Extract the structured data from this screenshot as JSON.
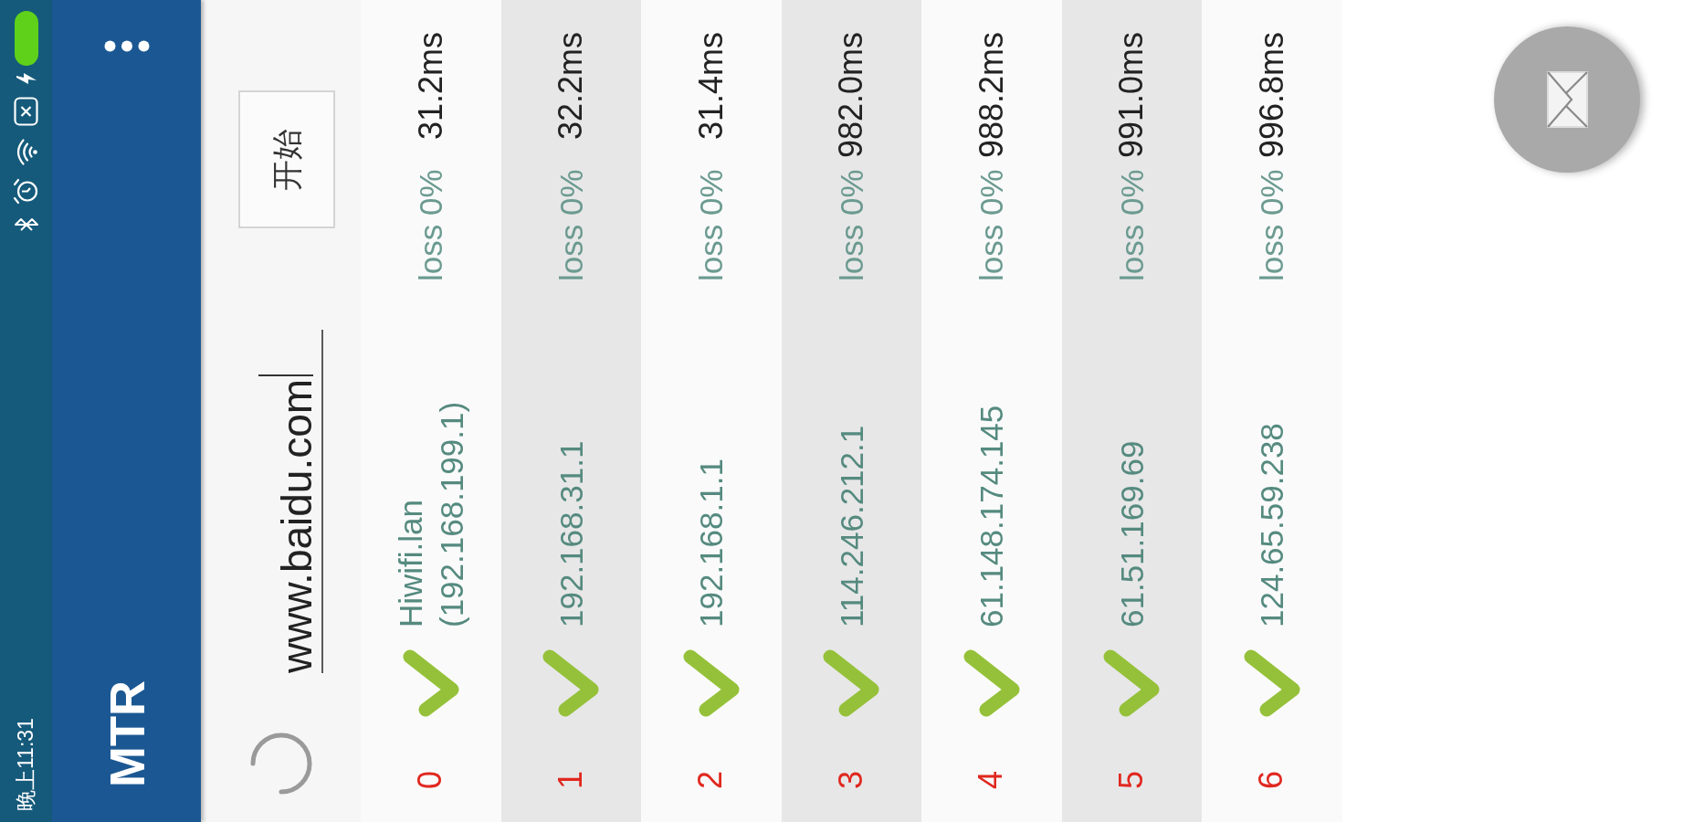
{
  "status_bar": {
    "time": "晚上11:31"
  },
  "app_bar": {
    "title": "MTR"
  },
  "toolbar": {
    "loading": true,
    "host_field": {
      "value": "www.baidu.com"
    },
    "start_button": {
      "label": "开始"
    }
  },
  "hops": [
    {
      "index": "0",
      "reachable": true,
      "host": "Hiwifi.lan (192.168.199.1)",
      "loss": "loss 0%",
      "latency": "31.2ms"
    },
    {
      "index": "1",
      "reachable": true,
      "host": "192.168.31.1",
      "loss": "loss 0%",
      "latency": "32.2ms"
    },
    {
      "index": "2",
      "reachable": true,
      "host": "192.168.1.1",
      "loss": "loss 0%",
      "latency": "31.4ms"
    },
    {
      "index": "3",
      "reachable": true,
      "host": "114.246.212.1",
      "loss": "loss 0%",
      "latency": "982.0ms"
    },
    {
      "index": "4",
      "reachable": true,
      "host": "61.148.174.145",
      "loss": "loss 0%",
      "latency": "988.2ms"
    },
    {
      "index": "5",
      "reachable": true,
      "host": "61.51.169.69",
      "loss": "loss 0%",
      "latency": "991.0ms"
    },
    {
      "index": "6",
      "reachable": true,
      "host": "124.65.59.238",
      "loss": "loss 0%",
      "latency": "996.8ms"
    }
  ]
}
